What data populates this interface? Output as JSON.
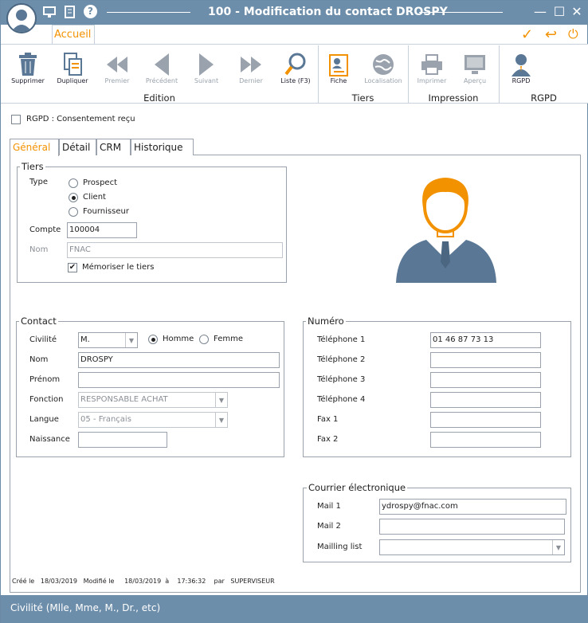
{
  "window": {
    "title": "100 - Modification du contact DROSPY"
  },
  "ribbon": {
    "tab": "Accueil",
    "tools": {
      "delete": "Supprimer",
      "duplicate": "Dupliquer",
      "first": "Premier",
      "previous": "Précédent",
      "next": "Suivant",
      "last": "Dernier",
      "list": "Liste (F3)",
      "card": "Fiche",
      "location": "Localisation",
      "print": "Imprimer",
      "preview": "Aperçu",
      "gdpr": "RGPD"
    },
    "groups": {
      "edition": "Edition",
      "tiers": "Tiers",
      "impression": "Impression",
      "rgpd": "RGPD"
    }
  },
  "consent": {
    "label": "RGPD : Consentement reçu",
    "checked": false
  },
  "tabs": [
    "Général",
    "Détail",
    "CRM",
    "Historique"
  ],
  "tiers": {
    "legend": "Tiers",
    "type_label": "Type",
    "options": [
      "Prospect",
      "Client",
      "Fournisseur"
    ],
    "selected": "Client",
    "account_label": "Compte",
    "account_value": "100004",
    "name_label": "Nom",
    "name_value": "FNAC",
    "remember_label": "Mémoriser le tiers",
    "remember_checked": true
  },
  "contact": {
    "legend": "Contact",
    "civility_label": "Civilité",
    "civility_value": "M.",
    "gender_options": [
      "Homme",
      "Femme"
    ],
    "gender_selected": "Homme",
    "lastname_label": "Nom",
    "lastname_value": "DROSPY",
    "firstname_label": "Prénom",
    "firstname_value": "",
    "function_label": "Fonction",
    "function_value": "RESPONSABLE ACHAT",
    "language_label": "Langue",
    "language_value": "05 - Français",
    "birth_label": "Naissance",
    "birth_value": ""
  },
  "numero": {
    "legend": "Numéro",
    "rows": [
      {
        "label": "Téléphone 1",
        "value": "01 46 87 73 13"
      },
      {
        "label": "Téléphone 2",
        "value": ""
      },
      {
        "label": "Téléphone 3",
        "value": ""
      },
      {
        "label": "Téléphone 4",
        "value": ""
      },
      {
        "label": "Fax 1",
        "value": ""
      },
      {
        "label": "Fax 2",
        "value": ""
      }
    ]
  },
  "email": {
    "legend": "Courrier électronique",
    "mail1_label": "Mail 1",
    "mail1_value": "ydrospy@fnac.com",
    "mail2_label": "Mail 2",
    "mail2_value": "",
    "mailing_label": "Mailling list",
    "mailing_value": ""
  },
  "footer": {
    "created_label": "Créé le",
    "created_date": "18/03/2019",
    "modified_label": "Modifié le",
    "modified_date": "18/03/2019",
    "at_label": "à",
    "modified_time": "17:36:32",
    "by_label": "par",
    "user": "SUPERVISEUR"
  },
  "status_text": "Civilité (Mlle, Mme, M., Dr., etc)",
  "colors": {
    "accent": "#f39200",
    "titlebar": "#6d8eaa",
    "icon_blue": "#5a7896"
  }
}
